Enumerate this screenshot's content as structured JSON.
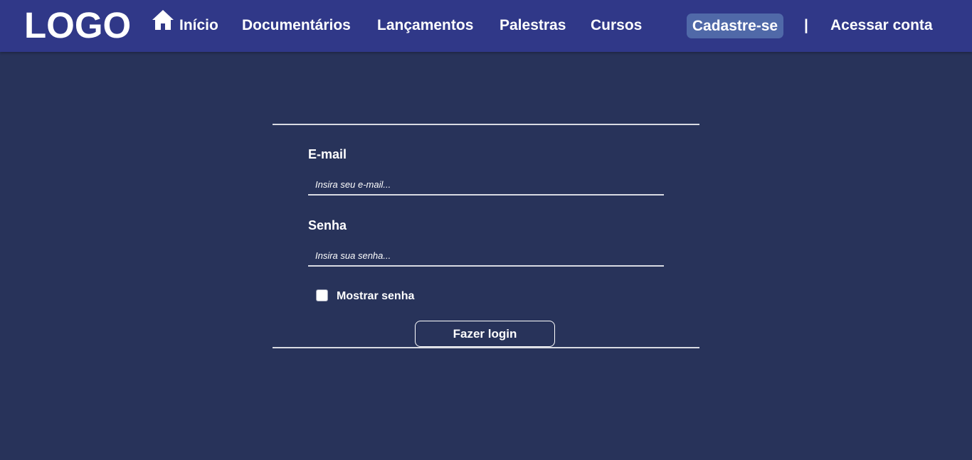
{
  "header": {
    "logo": "LOGO",
    "home_icon": "house-icon",
    "nav": {
      "inicio": "Início",
      "documentarios": "Documentários",
      "lancamentos": "Lançamentos",
      "palestras": "Palestras",
      "cursos": "Cursos"
    },
    "signup": "Cadastre-se",
    "separator": "|",
    "login_link": "Acessar conta"
  },
  "form": {
    "email_label": "E-mail",
    "email_placeholder": "Insira seu e-mail...",
    "email_value": "",
    "password_label": "Senha",
    "password_placeholder": "Insira sua senha...",
    "password_value": "",
    "show_password_label": "Mostrar senha",
    "show_password_checked": false,
    "submit_label": "Fazer login"
  },
  "colors": {
    "page_background": "#28335a",
    "navbar_background": "#303888",
    "signup_highlight": "#5069a8",
    "text": "#ffffff",
    "divider": "#d9dbe3"
  }
}
